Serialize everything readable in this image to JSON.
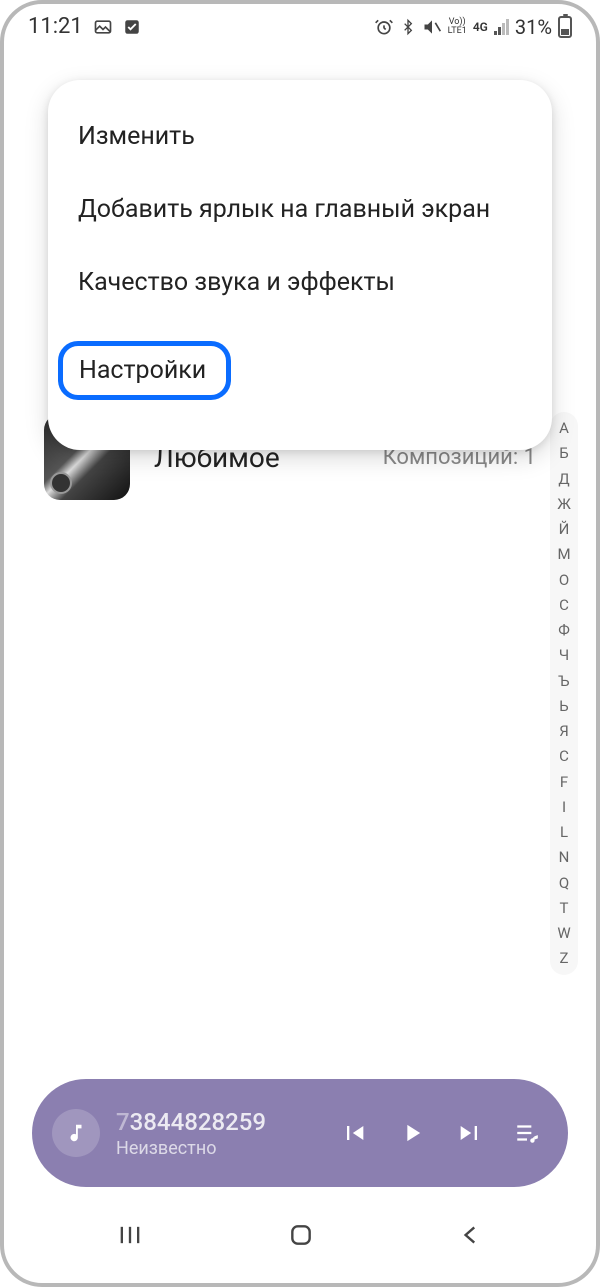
{
  "status": {
    "time": "11:21",
    "battery_pct": "31%",
    "volte": "Vo))\nLTE1",
    "network": "4G"
  },
  "menu": {
    "edit": "Изменить",
    "add_shortcut": "Добавить ярлык на главный экран",
    "sound_quality": "Качество звука и эффекты",
    "settings": "Настройки"
  },
  "playlist": {
    "title": "Любимое",
    "count": "Композиций: 1"
  },
  "index_rail": [
    "А",
    "Б",
    "Д",
    "Ж",
    "Й",
    "М",
    "О",
    "С",
    "Ф",
    "Ч",
    "Ъ",
    "Ь",
    "Я",
    "C",
    "F",
    "I",
    "L",
    "N",
    "Q",
    "T",
    "W",
    "Z"
  ],
  "player": {
    "track_lead": "7",
    "track_main": "3844828259",
    "track_trail": "",
    "artist": "Неизвестно"
  }
}
